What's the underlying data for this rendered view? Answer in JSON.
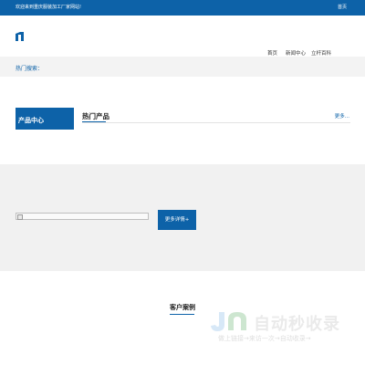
{
  "topbar": {
    "welcome": "欢迎来到重庆服装加工厂家网站!",
    "home": "首页"
  },
  "nav": {
    "items": [
      "首页",
      "新闻中心",
      "立杆百科"
    ]
  },
  "hot_search": {
    "label": "热门搜索："
  },
  "product_center": {
    "title": "产品中心"
  },
  "hot_products": {
    "title": "热门产品",
    "more": "更多..."
  },
  "promo": {
    "button": "更多详情+"
  },
  "cases": {
    "title": "客户案例"
  },
  "watermark": {
    "title": "自动秒收录",
    "subtitle": "做上链接→来访一次→自动收录→"
  },
  "colors": {
    "primary": "#0d62a8",
    "band": "#f1f1f1",
    "hotbar": "#f3f3f3"
  },
  "icons": {
    "logo": "site-logo-icon",
    "broken_image": "broken-image-icon"
  }
}
